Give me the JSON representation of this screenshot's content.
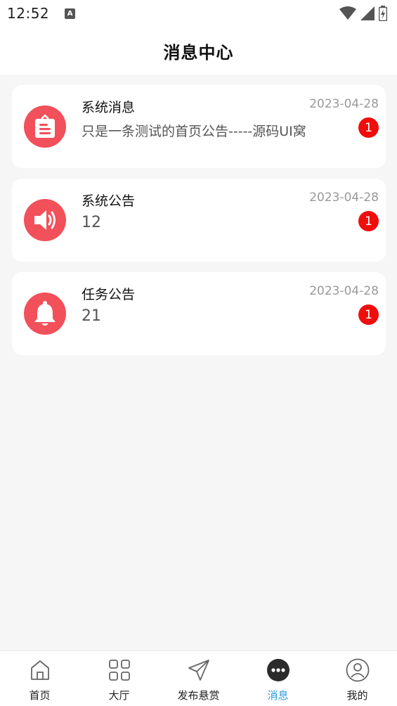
{
  "status_bar": {
    "time": "12:52",
    "notif_icon": "A"
  },
  "header": {
    "title": "消息中心"
  },
  "messages": [
    {
      "icon": "notice-board-icon",
      "title": "系统消息",
      "subtitle": "只是一条测试的首页公告-----源码UI窝",
      "date": "2023-04-28",
      "badge": "1"
    },
    {
      "icon": "speaker-icon",
      "title": "系统公告",
      "subtitle": "12",
      "date": "2023-04-28",
      "badge": "1"
    },
    {
      "icon": "bell-icon",
      "title": "任务公告",
      "subtitle": "21",
      "date": "2023-04-28",
      "badge": "1"
    }
  ],
  "tabbar": {
    "active": "消息",
    "items": [
      {
        "label": "首页",
        "icon": "home-icon"
      },
      {
        "label": "大厅",
        "icon": "grid-icon"
      },
      {
        "label": "发布悬赏",
        "icon": "send-icon"
      },
      {
        "label": "消息",
        "icon": "chat-dots-icon"
      },
      {
        "label": "我的",
        "icon": "user-icon"
      }
    ]
  },
  "colors": {
    "icon_bg": "#f2505a",
    "badge": "#f20d0d",
    "active_tab": "#2a9be0"
  }
}
